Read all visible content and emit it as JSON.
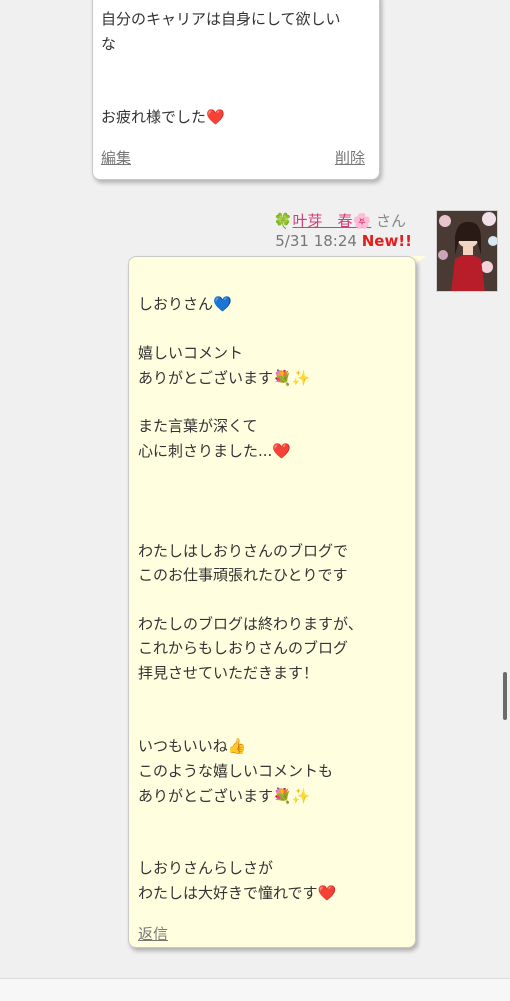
{
  "prev_comment": {
    "lines": [
      "自分のキャリアは自身にして欲しい",
      "な",
      "",
      "お疲れ様でした❤️"
    ],
    "edit_label": "編集",
    "delete_label": "削除"
  },
  "reply_comment": {
    "author_prefix": "🍀",
    "author_name": "叶芽　春🌸",
    "author_suffix": "さん",
    "date": "5/31 18:24",
    "new_badge": "New!!",
    "lines": [
      "しおりさん💙",
      "嬉しいコメント",
      "ありがとございます💐✨",
      "また言葉が深くて",
      "心に刺さりました...❤️",
      "わたしはしおりさんのブログで",
      "このお仕事頑張れたひとりです",
      "わたしのブログは終わりますが、",
      "これからもしおりさんのブログ",
      "拝見させていただきます！",
      "いつもいいね👍",
      "このような嬉しいコメントも",
      "ありがとございます💐✨",
      "しおりさんらしさが",
      "わたしは大好きで憧れです❤️"
    ],
    "reply_label": "返信"
  }
}
